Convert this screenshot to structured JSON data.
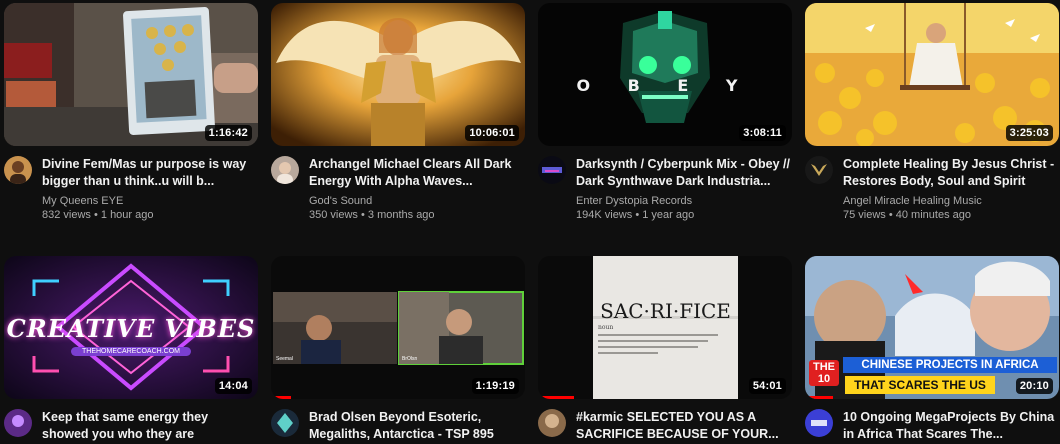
{
  "videos": [
    {
      "title": "Divine Fem/Mas ur purpose is way bigger than u think..u will b...",
      "channel": "My Queens EYE",
      "views": "832 views",
      "age": "1 hour ago",
      "duration": "1:16:42"
    },
    {
      "title": "Archangel Michael Clears All Dark Energy With Alpha Waves...",
      "channel": "God's Sound",
      "views": "350 views",
      "age": "3 months ago",
      "duration": "10:06:01"
    },
    {
      "title": "Darksynth / Cyberpunk Mix - Obey // Dark Synthwave Dark Industria...",
      "channel": "Enter Dystopia Records",
      "views": "194K views",
      "age": "1 year ago",
      "duration": "3:08:11",
      "thumb_text": "O B E Y"
    },
    {
      "title": "Complete Healing By Jesus Christ - Restores Body, Soul and Spirit",
      "channel": "Angel Miracle Healing Music",
      "views": "75 views",
      "age": "40 minutes ago",
      "duration": "3:25:03"
    },
    {
      "title": "Keep that same energy they showed you who they are",
      "channel": "",
      "views": "",
      "age": "",
      "duration": "14:04",
      "thumb_text": "CREATIVE VIBES",
      "thumb_subtext": "THEHOMECARECOACH.COM"
    },
    {
      "title": "Brad Olsen Beyond Esoteric, Megaliths, Antarctica - TSP 895",
      "channel": "",
      "views": "",
      "age": "",
      "duration": "1:19:19",
      "watched_fraction": 0.08
    },
    {
      "title": "#karmic SELECTED YOU AS A SACRIFICE BECAUSE OF YOUR...",
      "channel": "",
      "views": "",
      "age": "",
      "duration": "54:01",
      "thumb_text": "SAC·RI·FICE",
      "thumb_subtext": "noun",
      "watched_fraction": 0.14
    },
    {
      "title": "10 Ongoing MegaProjects By China in Africa That Scares The...",
      "channel": "",
      "views": "",
      "age": "",
      "duration": "20:10",
      "thumb_text": "CHINESE PROJECTS IN AFRICA",
      "thumb_text2": "THAT SCARES THE US",
      "thumb_badge": "THE 10",
      "watched_fraction": 0.11
    }
  ],
  "colors": {
    "background": "#0f0f0f",
    "progress": "#ff0000",
    "meta_text": "#aaaaaa"
  }
}
